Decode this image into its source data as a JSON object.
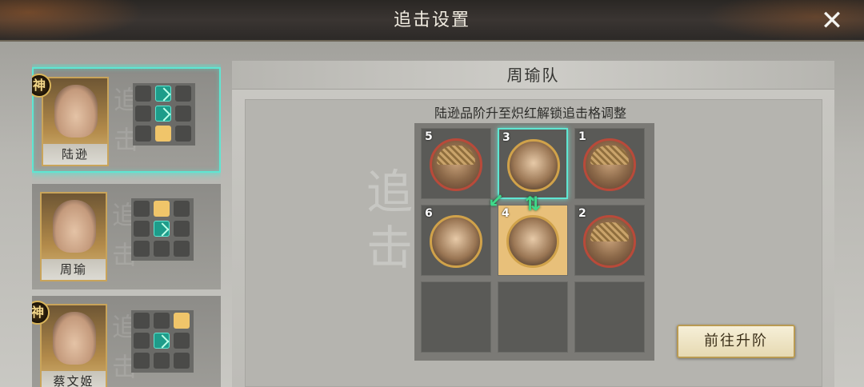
{
  "header": {
    "title": "追击设置",
    "close_icon": "close-icon"
  },
  "heroes": [
    {
      "name": "陆逊",
      "badge": "神",
      "selected": true
    },
    {
      "name": "周瑜",
      "badge": "",
      "selected": false
    },
    {
      "name": "蔡文姬",
      "badge": "神",
      "selected": false
    }
  ],
  "card_watermark": "追击",
  "team": {
    "title": "周瑜队",
    "hint": "陆逊品阶升至炽红解锁追击格调整",
    "watermark": "追击",
    "slots": [
      {
        "num": "5"
      },
      {
        "num": "3"
      },
      {
        "num": "1"
      },
      {
        "num": "6"
      },
      {
        "num": "4"
      },
      {
        "num": "2"
      },
      {
        "num": ""
      },
      {
        "num": ""
      },
      {
        "num": ""
      }
    ]
  },
  "upgrade_button": "前往升阶",
  "colors": {
    "accent": "#5fe6d2",
    "gold": "#f0c56a",
    "arrow": "#3fd98a"
  }
}
